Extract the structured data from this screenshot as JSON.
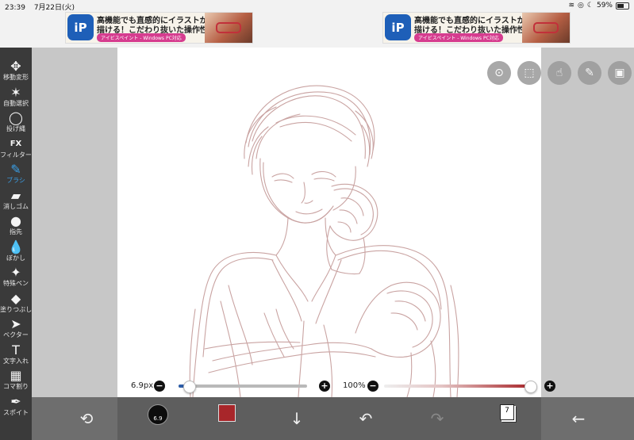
{
  "status_bar": {
    "time": "23:39",
    "date": "7月22日(火)",
    "battery": "59%"
  },
  "ads": [
    {
      "logo": "iP",
      "line1": "高機能でも直感的にイラストが",
      "line2": "描ける！こだわり抜いた操作性！",
      "tag": "アイビスペイント - Windows PC対応"
    },
    {
      "logo": "iP",
      "line1": "高機能でも直感的にイラストが",
      "line2": "描ける！こだわり抜いた操作性！",
      "tag": "アイビスペイント - Windows PC対応"
    }
  ],
  "toolbar": {
    "tools": [
      {
        "label": "移動変形",
        "icon": "move-icon",
        "glyph": "✥"
      },
      {
        "label": "自動選択",
        "icon": "magic-wand-icon",
        "glyph": "✶"
      },
      {
        "label": "投げ縄",
        "icon": "lasso-icon",
        "glyph": "◯"
      },
      {
        "label": "フィルター",
        "icon": "fx-icon",
        "glyph": "FX"
      },
      {
        "label": "ブラシ",
        "icon": "brush-icon",
        "glyph": "✎",
        "active": true
      },
      {
        "label": "消しゴム",
        "icon": "eraser-icon",
        "glyph": "▰"
      },
      {
        "label": "指先",
        "icon": "finger-icon",
        "glyph": "●"
      },
      {
        "label": "ぼかし",
        "icon": "blur-drop-icon",
        "glyph": "💧"
      },
      {
        "label": "特殊ペン",
        "icon": "special-pen-icon",
        "glyph": "✦"
      },
      {
        "label": "塗りつぶし",
        "icon": "fill-bucket-icon",
        "glyph": "◆"
      },
      {
        "label": "ベクター",
        "icon": "vector-icon",
        "glyph": "➤"
      },
      {
        "label": "文字入れ",
        "icon": "text-icon",
        "glyph": "T"
      },
      {
        "label": "コマ割り",
        "icon": "frame-divider-icon",
        "glyph": "▦"
      },
      {
        "label": "スポイト",
        "icon": "eyedropper-icon",
        "glyph": "✒"
      }
    ]
  },
  "canvas_tools": [
    "toggle-icon",
    "selection-icon",
    "hand-icon",
    "pencil-icon",
    "image-icon"
  ],
  "slider": {
    "brush_size": "6.9px",
    "brush_size_fraction": 0.08,
    "opacity": "100%",
    "opacity_fraction": 1.0,
    "minus": "−",
    "plus": "+"
  },
  "bottom": {
    "brush_preview_label": "6.9",
    "current_color": "#a8262a",
    "layer_count": "7"
  },
  "colors": {
    "toolbar_bg": "#3a3a3a",
    "active_tool": "#3aa0e8",
    "sketch_stroke": "#c49a98"
  }
}
